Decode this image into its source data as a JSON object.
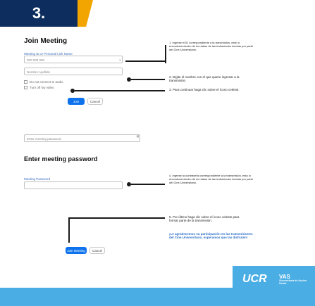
{
  "step": {
    "number": "3."
  },
  "card1": {
    "title": "Join Meeting",
    "field_meeting_id_label": "Meeting ID or Personal Link Name",
    "field_meeting_id_value": "000 000 000",
    "field_name_value": "Nombre Apellido",
    "checkbox_audio": "Do not connect to audio",
    "checkbox_video": "Turn off my video",
    "join_button": "Join",
    "cancel_button": "Cancel"
  },
  "card1_notes": {
    "note1": "1. Ingrese el ID correspondiente a la transmisión, este lo encontrará dentro de los datos de las invitaciones hechas por parte del Cine Universitario.",
    "note2": "2. Digite el nombre con el que quiere ingresar a la transmisión.",
    "note3": "3. Para continuar haga clic sobre el ícono celeste."
  },
  "card2": {
    "header_field": "Enter meeting password",
    "title": "Enter meeting password",
    "field_password_label": "Meeting Password",
    "join_button": "Join Meeting",
    "cancel_button": "Cancel"
  },
  "card2_notes": {
    "note4": "4. Ingrese la contraseña correspondiente a la transmisión, esta lo encontrará dentro de los datos de las invitaciones hechas por parte del Cine Universitario.",
    "note5": "5. Por último haga clic sobre el ícono celeste para formar parte de la transmisión.",
    "thanks": "¡Le agradecemos su participación en las transmisiones del Cine Universitario, esperamos que las disfruten!"
  },
  "footer": {
    "logo": "UCR",
    "vas_line1": "VAS",
    "vas_line2": "Vicerrectoría de Acción Social"
  },
  "colors": {
    "navy": "#0d2d5e",
    "orange": "#f2a400",
    "blue_button": "#0e72ed",
    "footer": "#4aaee5"
  }
}
